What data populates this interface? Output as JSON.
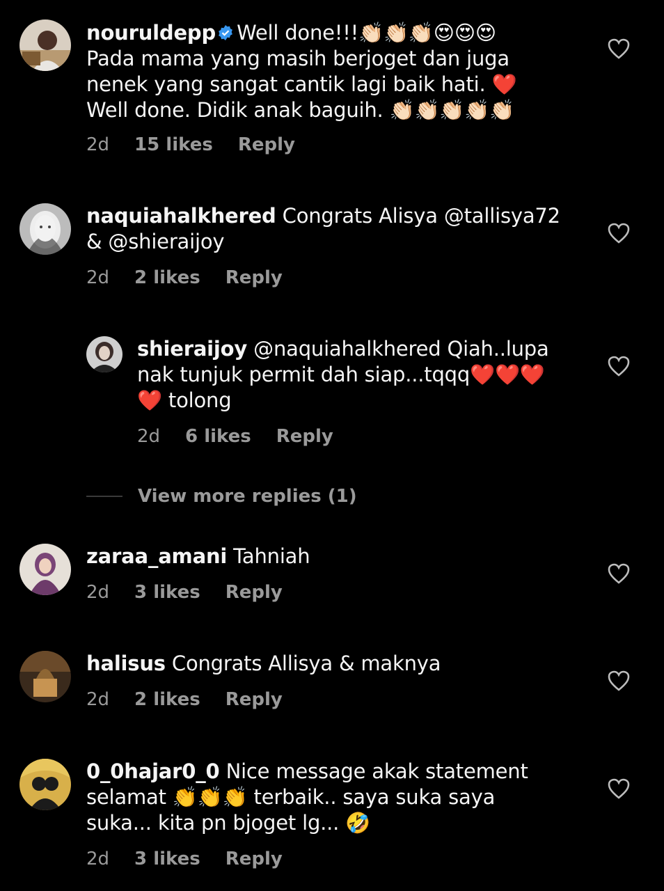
{
  "comments": [
    {
      "username": "nouruldepp",
      "verified": true,
      "text_lines": [
        "Well done!!!👏🏻👏🏻👏🏻😍😍😍",
        "Pada mama yang masih berjoget dan juga",
        "nenek yang sangat cantik lagi baik hati. ❤️",
        "Well done.  Didik anak baguih. 👏🏻👏🏻👏🏻👏🏻👏🏻"
      ],
      "time": "2d",
      "likes": "15 likes",
      "reply": "Reply"
    },
    {
      "username": "naquiahalkhered",
      "text_lines": [
        "Congrats Alisya @tallisya72",
        "& @shieraijoy"
      ],
      "time": "2d",
      "likes": "2 likes",
      "reply": "Reply"
    },
    {
      "username": "shieraijoy",
      "text_lines": [
        "@naquiahalkhered Qiah..lupa",
        "nak tunjuk permit dah siap...tqqq❤️❤️❤️",
        "❤️ tolong"
      ],
      "time": "2d",
      "likes": "6 likes",
      "reply": "Reply"
    },
    {
      "username": "zaraa_amani",
      "text_lines": [
        "Tahniah"
      ],
      "time": "2d",
      "likes": "3 likes",
      "reply": "Reply"
    },
    {
      "username": "halisus",
      "text_lines": [
        "Congrats Allisya & maknya"
      ],
      "time": "2d",
      "likes": "2 likes",
      "reply": "Reply"
    },
    {
      "username": "0_0hajar0_0",
      "text_lines": [
        "Nice message akak statement",
        "selamat 👏👏👏 terbaik.. saya suka saya",
        "suka... kita pn bjoget lg... 🤣"
      ],
      "time": "2d",
      "likes": "3 likes",
      "reply": "Reply"
    }
  ],
  "view_more_replies": "View more replies (1)",
  "icons": {
    "like": "heart-outline-icon",
    "verified": "verified-badge-icon"
  },
  "colors": {
    "background": "#000000",
    "text": "#f5f5f5",
    "muted": "#9a9a9a",
    "verified": "#3897f0"
  }
}
